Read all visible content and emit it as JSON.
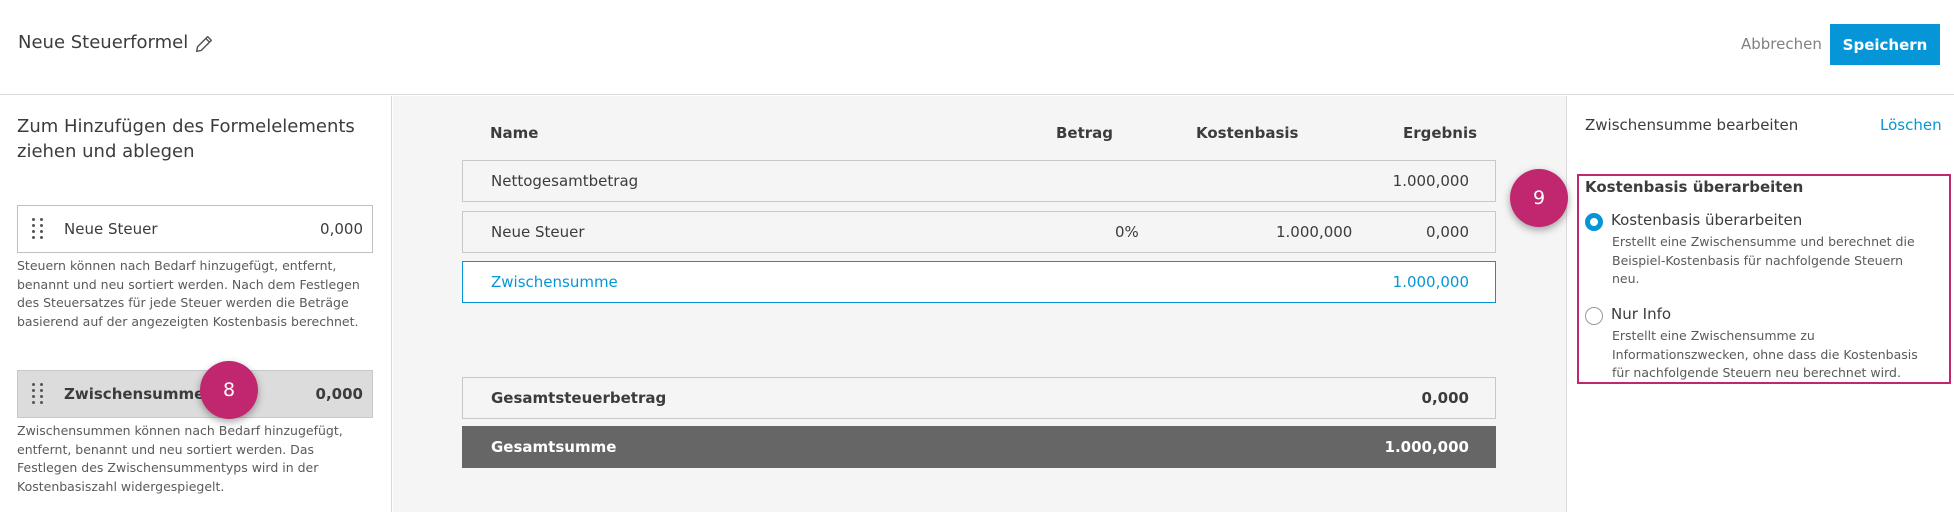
{
  "header": {
    "title": "Neue Steuerformel",
    "cancel_label": "Abbrechen",
    "save_label": "Speichern"
  },
  "left_panel": {
    "heading": "Zum Hinzufügen des Formelelements ziehen und ablegen",
    "items": [
      {
        "label": "Neue Steuer",
        "value": "0,000",
        "help": "Steuern können nach Bedarf hinzugefügt, entfernt, benannt und neu sortiert werden. Nach dem Festlegen des Steuersatzes für jede Steuer werden die Beträge basierend auf der angezeigten Kostenbasis berechnet."
      },
      {
        "label": "Zwischensumme",
        "value": "0,000",
        "help": "Zwischensummen können nach Bedarf hinzugefügt, entfernt, benannt und neu sortiert werden. Das Festlegen des Zwischensummentyps wird in der Kostenbasiszahl widergespiegelt."
      }
    ]
  },
  "markers": {
    "m8": "8",
    "m9": "9"
  },
  "table": {
    "columns": {
      "name": "Name",
      "betrag": "Betrag",
      "kostenbasis": "Kostenbasis",
      "ergebnis": "Ergebnis"
    },
    "rows": [
      {
        "name": "Nettogesamtbetrag",
        "betrag": "",
        "kostenbasis": "",
        "ergebnis": "1.000,000"
      },
      {
        "name": "Neue Steuer",
        "betrag": "0%",
        "kostenbasis": "1.000,000",
        "ergebnis": "0,000"
      },
      {
        "name": "Zwischensumme",
        "betrag": "",
        "kostenbasis": "",
        "ergebnis": "1.000,000"
      }
    ],
    "totals": [
      {
        "name": "Gesamtsteuerbetrag",
        "ergebnis": "0,000"
      },
      {
        "name": "Gesamtsumme",
        "ergebnis": "1.000,000"
      }
    ]
  },
  "right_panel": {
    "title": "Zwischensumme bearbeiten",
    "delete_label": "Löschen",
    "section_title": "Kostenbasis überarbeiten",
    "options": [
      {
        "label": "Kostenbasis überarbeiten",
        "desc": "Erstellt eine Zwischensumme und berechnet die Beispiel-Kostenbasis für nachfolgende Steuern neu.",
        "checked": true
      },
      {
        "label": "Nur Info",
        "desc": "Erstellt eine Zwischensumme zu Informationszwecken, ohne dass die Kostenbasis für nachfolgende Steuern neu berechnet wird.",
        "checked": false
      }
    ]
  },
  "colors": {
    "accent": "#0696d7",
    "marker": "#c0276f",
    "total_row": "#666666"
  },
  "icons": {
    "edit": "pencil-icon",
    "drag": "drag-handle-icon"
  }
}
